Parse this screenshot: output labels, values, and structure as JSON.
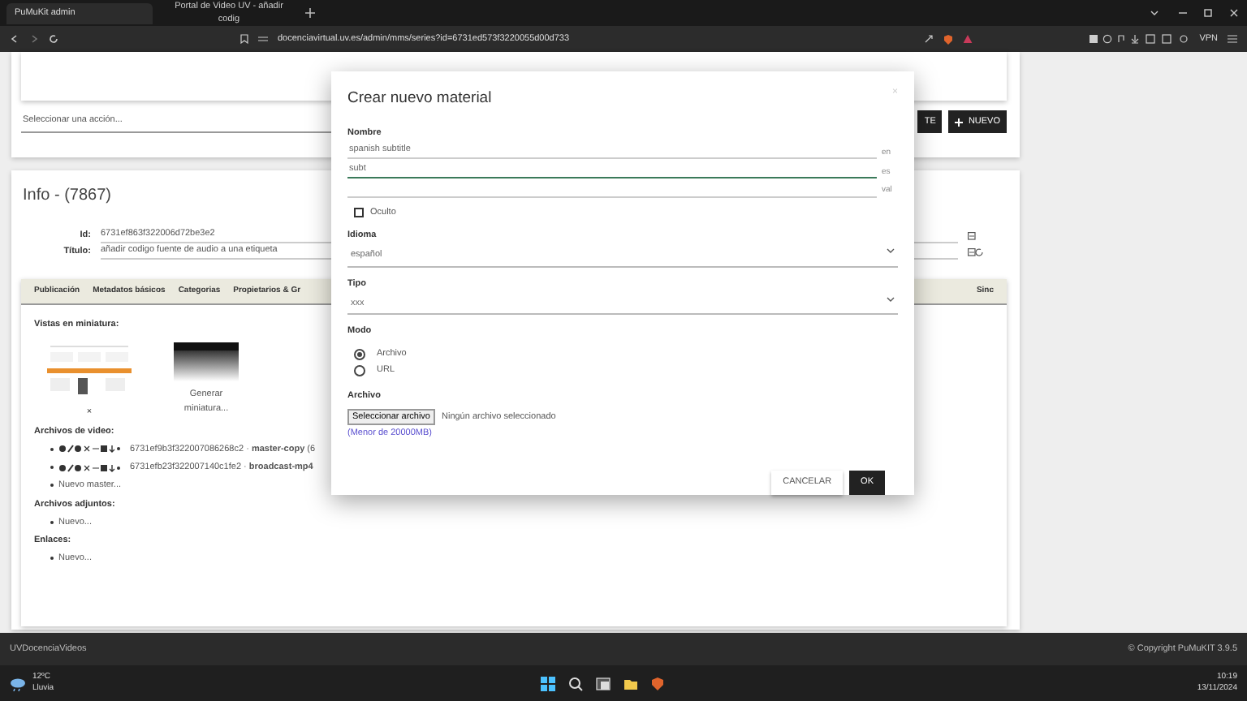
{
  "browser": {
    "tabs": [
      {
        "title": "PuMuKit admin",
        "selected": true
      },
      {
        "title": "Portal de Video UV - añadir codig",
        "selected": false
      }
    ],
    "url": "docenciavirtual.uv.es/admin/mms/series?id=6731ed573f3220055d00d733",
    "vpn": "VPN"
  },
  "page": {
    "action_select": "Seleccionar una acción...",
    "buttons": [
      {
        "label": "TE",
        "kind": "plain"
      },
      {
        "label": "NUEVO",
        "kind": "add"
      }
    ],
    "info": {
      "title": "Info - (7867)",
      "fields": [
        {
          "label": "Id:",
          "value": "6731ef863f322006d72be3e2"
        },
        {
          "label": "Título:",
          "value": "añadir codigo fuente de audio a una etiqueta"
        }
      ],
      "tabs": [
        {
          "label": "Publicación",
          "selected": false
        },
        {
          "label": "Metadatos básicos",
          "selected": false
        },
        {
          "label": "Categorias",
          "selected": false
        },
        {
          "label": "Propietarios & Gr",
          "selected": false
        },
        {
          "label": "Sinc",
          "selected": false
        }
      ],
      "thumbnails_label": "Vistas en miniatura:",
      "thumbnails": [
        {
          "caption": "×",
          "kind": "screenshot"
        },
        {
          "caption": "Generar miniatura...",
          "kind": "dark"
        }
      ],
      "sections": [
        {
          "heading": "Archivos de video:",
          "items": [
            {
              "kind": "file",
              "text": "6731ef9b3f322007086268c2 · **master-copy** (6"
            },
            {
              "kind": "file",
              "text": "6731efb23f322007140c1fe2 · **broadcast-mp4**"
            },
            {
              "kind": "new",
              "text": "Nuevo master..."
            }
          ]
        },
        {
          "heading": "Archivos adjuntos:",
          "items": [
            {
              "kind": "new",
              "text": "Nuevo..."
            }
          ]
        },
        {
          "heading": "Enlaces:",
          "items": [
            {
              "kind": "new",
              "text": "Nuevo..."
            }
          ]
        }
      ]
    }
  },
  "modal": {
    "title": "Crear nuevo material",
    "close": "×",
    "name_label": "Nombre",
    "name_fields": [
      {
        "value": "spanish subtitle",
        "lang": "en",
        "focused": false
      },
      {
        "value": "subt",
        "lang": "es",
        "focused": true
      },
      {
        "lang": "val",
        "focused": false
      }
    ],
    "hidden": {
      "label": "Oculto",
      "checked": false
    },
    "language": {
      "label": "Idioma",
      "value": "español"
    },
    "type": {
      "label": "Tipo",
      "value": "xxx"
    },
    "mode": {
      "label": "Modo",
      "options": [
        {
          "label": "Archivo",
          "selected": true
        },
        {
          "label": "URL",
          "selected": false
        }
      ]
    },
    "file": {
      "label": "Archivo",
      "button": "Seleccionar archivo",
      "status": "Ningún archivo seleccionado",
      "limit": "(Menor de 20000MB)"
    },
    "buttons": [
      {
        "label": "CANCELAR",
        "kind": "secondary"
      },
      {
        "label": "OK",
        "kind": "primary"
      }
    ]
  },
  "footer": {
    "left": "UVDocenciaVideos",
    "right": "© Copyright PuMuKIT 3.9.5"
  },
  "taskbar": {
    "temperature": "12ºC",
    "weather": "Lluvia",
    "time": "10:19",
    "date": "13/11/2024"
  }
}
